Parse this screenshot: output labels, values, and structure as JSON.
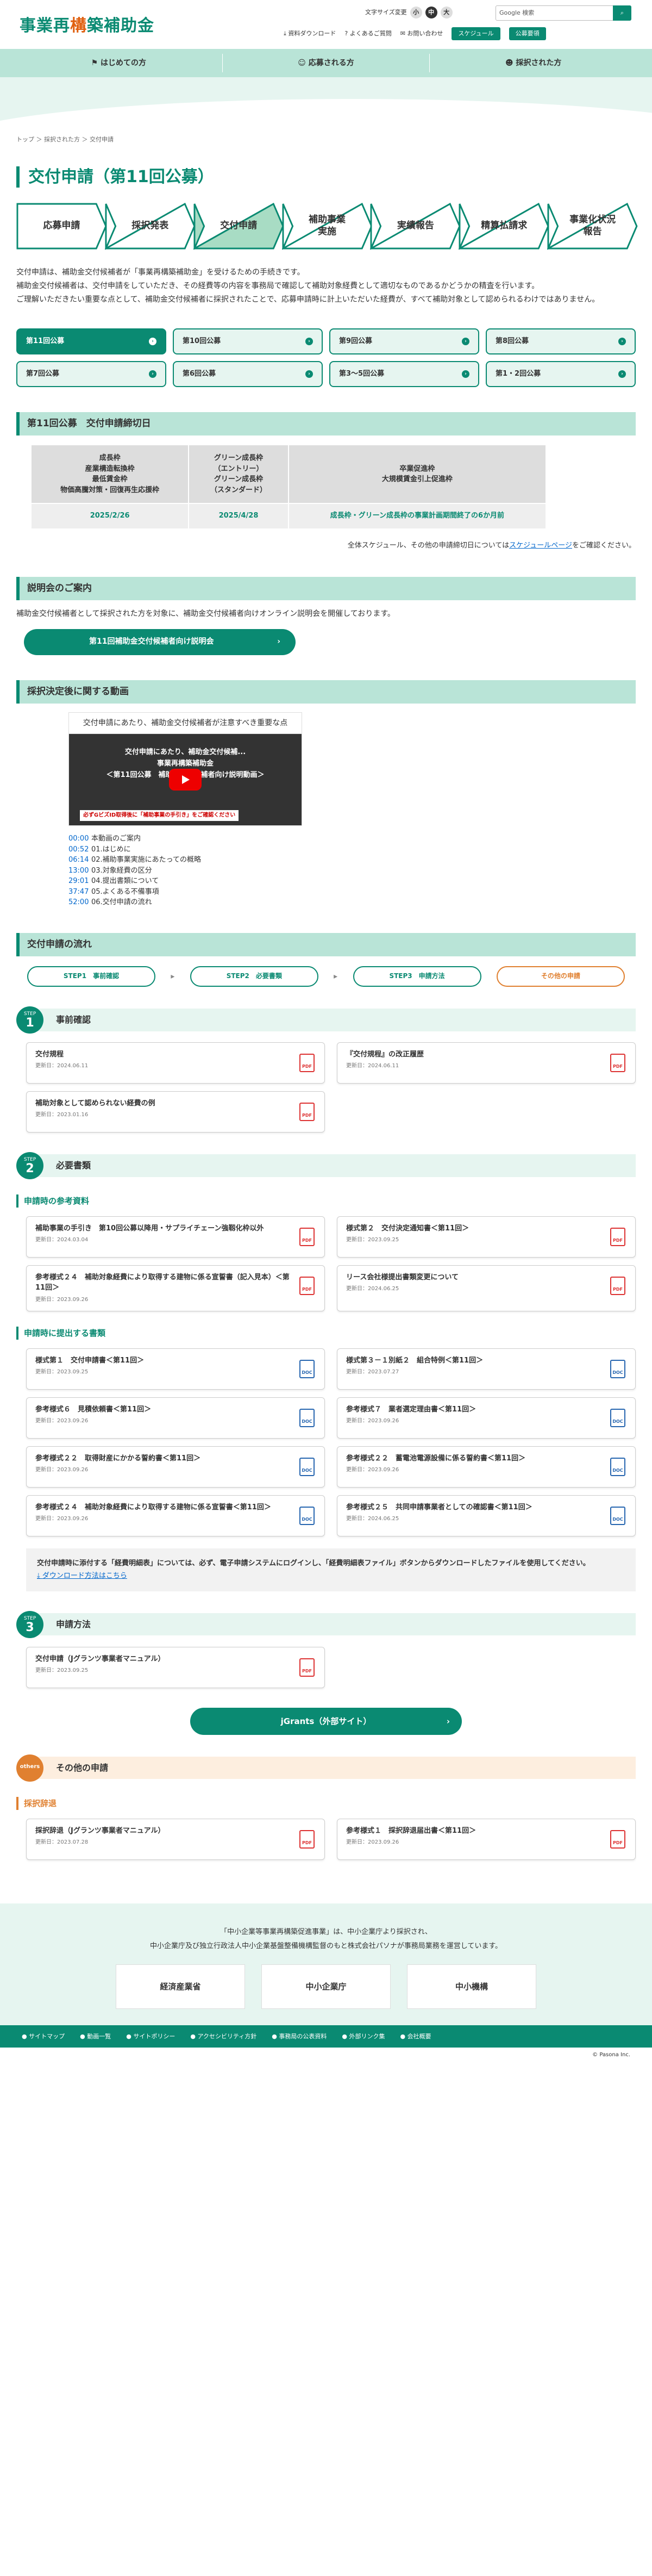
{
  "header": {
    "logo_a": "事業再",
    "logo_b": "構",
    "logo_c": "築補助金",
    "font_label": "文字サイズ変更",
    "font_small": "小",
    "font_mid": "中",
    "font_large": "大",
    "search_placeholder": "Google 検索",
    "links": [
      "資料ダウンロード",
      "よくあるご質問",
      "お問い合わせ"
    ],
    "btn_schedule": "スケジュール",
    "btn_koubo": "公募要領"
  },
  "gnav": [
    "はじめての方",
    "応募される方",
    "採択された方"
  ],
  "breadcrumb": "トップ ＞ 採択された方 ＞ 交付申請",
  "page_title": "交付申請（第11回公募）",
  "steps": [
    "応募申請",
    "採択発表",
    "交付申請",
    "補助事業\n実施",
    "実績報告",
    "精算払請求",
    "事業化状況\n報告"
  ],
  "active_step": 2,
  "intro": [
    "交付申請は、補助金交付候補者が「事業再構築補助金」を受けるための手続きです。",
    "補助金交付候補者は、交付申請をしていただき、その経費等の内容を事務局で確認して補助対象経費として適切なものであるかどうかの精査を行います。",
    "ご理解いただきたい重要な点として、補助金交付候補者に採択されたことで、応募申請時に計上いただいた経費が、すべて補助対象として認められるわけではありません。"
  ],
  "rounds": [
    "第11回公募",
    "第10回公募",
    "第9回公募",
    "第8回公募",
    "第7回公募",
    "第6回公募",
    "第3〜5回公募",
    "第1・2回公募"
  ],
  "deadline": {
    "heading": "第11回公募　交付申請締切日",
    "cols": [
      [
        "成長枠",
        "産業構造転換枠",
        "最低賃金枠",
        "物価高騰対策・回復再生応援枠"
      ],
      [
        "グリーン成長枠",
        "（エントリー）",
        "グリーン成長枠",
        "（スタンダード）"
      ],
      [
        "卒業促進枠",
        "大規模賃金引上促進枠"
      ]
    ],
    "vals": [
      "2025/2/26",
      "2025/4/28",
      "成長枠・グリーン成長枠の事業計画期間終了の6か月前"
    ],
    "note_a": "全体スケジュール、その他の申請締切日については",
    "note_link": "スケジュールページ",
    "note_b": "をご確認ください。"
  },
  "briefing": {
    "heading": "説明会のご案内",
    "text": "補助金交付候補者として採択された方を対象に、補助金交付候補者向けオンライン説明会を開催しております。",
    "btn": "第11回補助金交付候補者向け説明会"
  },
  "video": {
    "heading": "採択決定後に関する動画",
    "caption": "交付申請にあたり、補助金交付候補者が注意すべき重要な点",
    "thumb_title": "交付申請にあたり、補助金交付候補...",
    "thumb_t1": "事業再構築補助金",
    "thumb_t2": "＜第11回公募　補助金交付候補者向け説明動画＞",
    "thumb_sub": "必ずGビズID取得後に「補助事業の手引き」をご確認ください",
    "chapters": [
      {
        "t": "00:00",
        "l": "本動画のご案内"
      },
      {
        "t": "00:52",
        "l": "01.はじめに"
      },
      {
        "t": "06:14",
        "l": "02.補助事業実施にあたっての概略"
      },
      {
        "t": "13:00",
        "l": "03.対象経費の区分"
      },
      {
        "t": "29:01",
        "l": "04.提出書類について"
      },
      {
        "t": "37:47",
        "l": "05.よくある不備事項"
      },
      {
        "t": "52:00",
        "l": "06.交付申請の流れ"
      }
    ]
  },
  "flow": {
    "heading": "交付申請の流れ",
    "tabs": [
      "STEP1　事前確認",
      "STEP2　必要書類",
      "STEP3　申請方法",
      "その他の申請"
    ]
  },
  "step1": {
    "badge": "STEP",
    "num": "1",
    "title": "事前確認",
    "cards": [
      {
        "t": "交付規程",
        "d": "更新日：2024.06.11",
        "f": "PDF"
      },
      {
        "t": "『交付規程』の改正履歴",
        "d": "更新日：2024.06.11",
        "f": "PDF"
      },
      {
        "t": "補助対象として認められない経費の例",
        "d": "更新日：2023.01.16",
        "f": "PDF"
      }
    ]
  },
  "step2": {
    "badge": "STEP",
    "num": "2",
    "title": "必要書類",
    "sub1": "申請時の参考資料",
    "cards1": [
      {
        "t": "補助事業の手引き　第10回公募以降用・サプライチェーン強靱化枠以外",
        "d": "更新日：2024.03.04",
        "f": "PDF"
      },
      {
        "t": "様式第２　交付決定通知書＜第11回＞",
        "d": "更新日：2023.09.25",
        "f": "PDF"
      },
      {
        "t": "参考様式２４　補助対象経費により取得する建物に係る宣誓書（記入見本）＜第11回＞",
        "d": "更新日：2023.09.26",
        "f": "PDF"
      },
      {
        "t": "リース会社様提出書類変更について",
        "d": "更新日：2024.06.25",
        "f": "PDF"
      }
    ],
    "sub2": "申請時に提出する書類",
    "cards2": [
      {
        "t": "様式第１　交付申請書＜第11回＞",
        "d": "更新日：2023.09.25",
        "f": "DOC"
      },
      {
        "t": "様式第３－１別紙２　組合特例＜第11回＞",
        "d": "更新日：2023.07.27",
        "f": "DOC"
      },
      {
        "t": "参考様式６　見積依頼書＜第11回＞",
        "d": "更新日：2023.09.26",
        "f": "DOC"
      },
      {
        "t": "参考様式７　業者選定理由書＜第11回＞",
        "d": "更新日：2023.09.26",
        "f": "DOC"
      },
      {
        "t": "参考様式２２　取得財産にかかる誓約書＜第11回＞",
        "d": "更新日：2023.09.26",
        "f": "DOC"
      },
      {
        "t": "参考様式２２　蓄電池電源設備に係る誓約書＜第11回＞",
        "d": "更新日：2023.09.26",
        "f": "DOC"
      },
      {
        "t": "参考様式２４　補助対象経費により取得する建物に係る宣誓書＜第11回＞",
        "d": "更新日：2023.09.26",
        "f": "DOC"
      },
      {
        "t": "参考様式２５　共同申請事業者としての確認書＜第11回＞",
        "d": "更新日：2024.06.25",
        "f": "DOC"
      }
    ],
    "note": "交付申請時に添付する「経費明細表」については、必ず、電子申請システムにログインし、「経費明細表ファイル」ボタンからダウンロードしたファイルを使用してください。",
    "note_link": "ダウンロード方法はこちら"
  },
  "step3": {
    "badge": "STEP",
    "num": "3",
    "title": "申請方法",
    "cards": [
      {
        "t": "交付申請（Jグランツ事業者マニュアル）",
        "d": "更新日：2023.09.25",
        "f": "PDF"
      }
    ],
    "btn": "jGrants（外部サイト）"
  },
  "others": {
    "badge": "others",
    "title": "その他の申請",
    "sub": "採択辞退",
    "cards": [
      {
        "t": "採択辞退（Jグランツ事業者マニュアル）",
        "d": "更新日：2023.07.28",
        "f": "PDF"
      },
      {
        "t": "参考様式１　採択辞退届出書＜第11回＞",
        "d": "更新日：2023.09.26",
        "f": "PDF"
      }
    ]
  },
  "footer": {
    "t1": "「中小企業等事業再構築促進事業」は、中小企業庁より採択され、",
    "t2": "中小企業庁及び独立行政法人中小企業基盤整備機構監督のもと株式会社パソナが事務局業務を運営しています。",
    "logos": [
      "経済産業省",
      "中小企業庁",
      "中小機構"
    ],
    "nav": [
      "サイトマップ",
      "動画一覧",
      "サイトポリシー",
      "アクセシビリティ方針",
      "事務局の公表資料",
      "外部リンク集",
      "会社概要"
    ],
    "copyright": "© Pasona Inc."
  },
  "colors": {
    "primary": "#0a8a72",
    "light": "#b9e4d7",
    "accent": "#e08030",
    "pdf": "#d33",
    "doc": "#2766b0"
  }
}
